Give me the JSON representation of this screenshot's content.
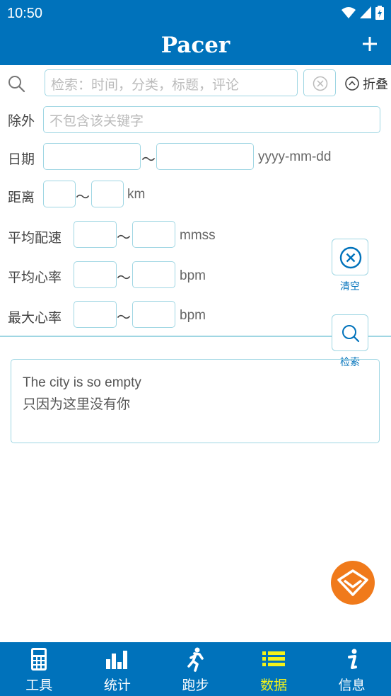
{
  "status_bar": {
    "time": "10:50"
  },
  "app_bar": {
    "title": "Pacer"
  },
  "search": {
    "placeholder": "检索：时间，分类，标题，评论",
    "fold_label": "折叠"
  },
  "filters": {
    "exclude_label": "除外",
    "exclude_placeholder": "不包含该关键字",
    "date_label": "日期",
    "date_format": "yyyy-mm-dd",
    "distance_label": "距离",
    "distance_unit": "km",
    "pace_label": "平均配速",
    "pace_unit": "mmss",
    "avg_hr_label": "平均心率",
    "avg_hr_unit": "bpm",
    "max_hr_label": "最大心率",
    "max_hr_unit": "bpm",
    "tilde": "～"
  },
  "actions": {
    "clear_label": "清空",
    "search_label": "检索"
  },
  "card": {
    "line1": "The city is so empty",
    "line2": "只因为这里没有你"
  },
  "bottom_nav": {
    "items": [
      {
        "label": "工具",
        "icon": "calculator-icon"
      },
      {
        "label": "统计",
        "icon": "bar-chart-icon"
      },
      {
        "label": "跑步",
        "icon": "runner-icon"
      },
      {
        "label": "数据",
        "icon": "list-icon"
      },
      {
        "label": "信息",
        "icon": "info-icon"
      }
    ],
    "active_index": 3
  },
  "colors": {
    "primary": "#0072bb",
    "border": "#9fd6e3",
    "active": "#f2f21a",
    "fab": "#f07a1b"
  }
}
